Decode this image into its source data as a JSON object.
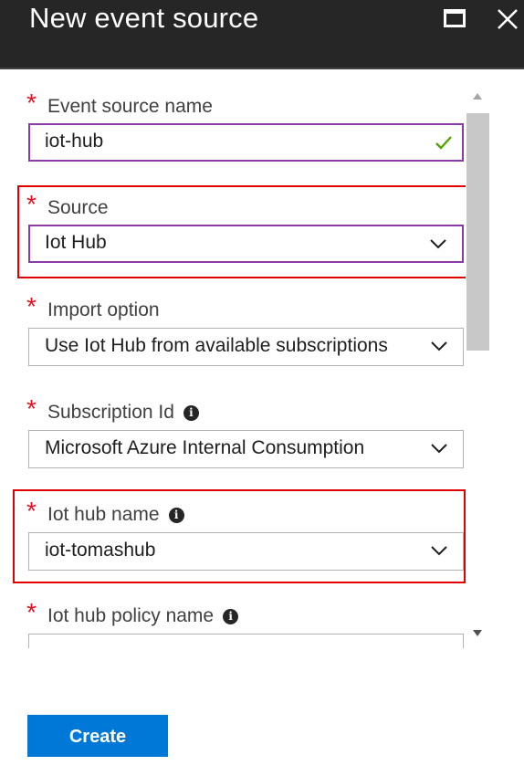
{
  "blade": {
    "title": "New event source",
    "maximize_icon": "maximize-icon",
    "close_icon": "close-icon"
  },
  "form": {
    "required_marker": "*",
    "fields": [
      {
        "label": "Event source name",
        "value": "iot-hub",
        "state": "valid",
        "icon": "checkmark-icon"
      },
      {
        "label": "Source",
        "value": "Iot Hub",
        "state": "dropdown"
      },
      {
        "label": "Import option",
        "value": "Use Iot Hub from available subscriptions",
        "state": "dropdown"
      },
      {
        "label": "Subscription Id",
        "value": "Microsoft Azure Internal Consumption",
        "state": "dropdown",
        "info": "i"
      },
      {
        "label": "Iot hub name",
        "value": "iot-tomashub",
        "state": "dropdown",
        "info": "i"
      },
      {
        "label": "Iot hub policy name",
        "value": "",
        "state": "dropdown",
        "info": "i"
      }
    ]
  },
  "actions": {
    "create_label": "Create"
  },
  "colors": {
    "header_bg": "#262626",
    "required": "#e81123",
    "focus_border": "#8a3aa5",
    "valid_check": "#57a300",
    "highlight": "#e00000",
    "primary_button": "#0078d7"
  }
}
